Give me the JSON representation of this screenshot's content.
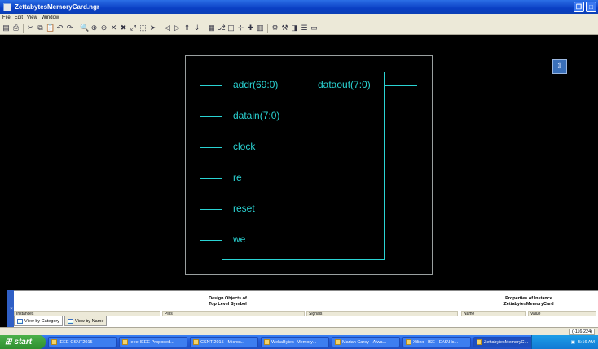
{
  "window": {
    "title": "ZettabytesMemoryCard.ngr"
  },
  "menu": [
    "File",
    "Edit",
    "View",
    "Window"
  ],
  "toolbar": {
    "icons": [
      "save-icon",
      "print-icon",
      "cut-icon",
      "copy-icon",
      "paste-icon",
      "undo-icon",
      "redo-icon",
      "find-icon",
      "zoom-in-icon",
      "zoom-out-icon",
      "delete-icon",
      "cross-icon",
      "zoom-full-icon",
      "zoom-box-icon",
      "pointer-icon",
      "back-icon",
      "forward-icon",
      "push-icon",
      "pop-icon",
      "schematic-icon",
      "hierarchy-icon",
      "view-icon",
      "pin-icon",
      "add-icon",
      "layout-icon",
      "config-icon",
      "tool-icon",
      "display-icon",
      "properties-icon",
      "window-icon"
    ]
  },
  "symbol": {
    "inputs": [
      {
        "label": "addr(69:0)",
        "bus": true
      },
      {
        "label": "datain(7:0)",
        "bus": true
      },
      {
        "label": "clock",
        "bus": false
      },
      {
        "label": "re",
        "bus": false
      },
      {
        "label": "reset",
        "bus": false
      },
      {
        "label": "we",
        "bus": false
      }
    ],
    "outputs": [
      {
        "label": "dataout(7:0)",
        "bus": true
      }
    ]
  },
  "panel": {
    "design_objects_title": "Design Objects of",
    "design_objects_subtitle": "Top Level Symbol",
    "properties_title": "Properties of Instance",
    "properties_subtitle": "ZettabytesMemoryCard",
    "columns": [
      "Instances",
      "Pins",
      "Signals",
      "Name",
      "Value"
    ],
    "tabs": [
      "View by Category",
      "View by Name"
    ]
  },
  "status": {
    "coords": "(-116,224)"
  },
  "taskbar": {
    "start_label": "start",
    "tasks": [
      "IEEE-CSNT2015",
      "Ieee-IEEE Proposed...",
      "CSNT 2015 - Micros...",
      "WekaBytes -Memory...",
      "Mariah Carey - Alwa...",
      "Xilinx - ISE - E:\\S\\Hs...",
      "ZettabytesMemoryC..."
    ],
    "clock": "5:16 AM"
  }
}
